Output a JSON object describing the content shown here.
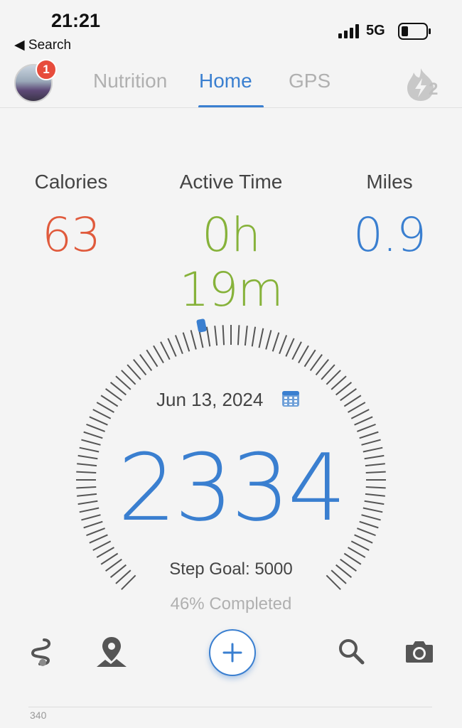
{
  "status_bar": {
    "time": "21:21",
    "back_label": "◀ Search",
    "network": "5G"
  },
  "header": {
    "notification_count": "1",
    "tabs": [
      {
        "label": "Nutrition",
        "active": false
      },
      {
        "label": "Home",
        "active": true
      },
      {
        "label": "GPS",
        "active": false
      }
    ],
    "streak_count": "2"
  },
  "stats": [
    {
      "label": "Calories",
      "value": "63",
      "color": "#e05a3c"
    },
    {
      "label": "Active Time",
      "value": "0h 19m",
      "color": "#86b23a"
    },
    {
      "label": "Miles",
      "value": "0.9",
      "color": "#3a7fd0"
    }
  ],
  "dial": {
    "date": "Jun 13, 2024",
    "steps": "2334",
    "goal_text": "Step Goal: 5000",
    "completed_text": "46% Completed",
    "progress": 0.46
  },
  "toolbar": {
    "items": [
      "route-icon",
      "map-pin-icon",
      "add-icon",
      "search-icon",
      "camera-icon"
    ]
  },
  "footer": {
    "value": "340"
  }
}
